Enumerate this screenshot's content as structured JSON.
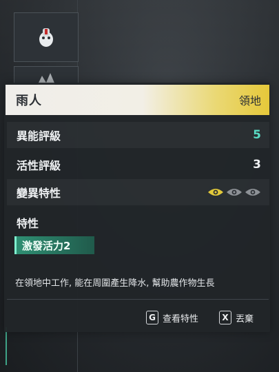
{
  "pal": {
    "name": "雨人",
    "suitability": "領地"
  },
  "stats": [
    {
      "label": "異能評級",
      "value": "5"
    },
    {
      "label": "活性評級",
      "value": "3"
    },
    {
      "label": "變異特性",
      "eyes_active": 1,
      "eyes_total": 3
    }
  ],
  "traits": {
    "header": "特性",
    "items": [
      "激發活力2"
    ],
    "description": "在領地中工作, 能在周圍產生降水, 幫助農作物生長"
  },
  "actions": [
    {
      "key": "G",
      "label": "查看特性"
    },
    {
      "key": "X",
      "label": "丟棄"
    }
  ],
  "colors": {
    "accent_teal": "#59dcc4",
    "eye_active": "#e2c93a",
    "eye_inactive": "#8d9196",
    "title_gradient_end": "#e5c83a"
  }
}
